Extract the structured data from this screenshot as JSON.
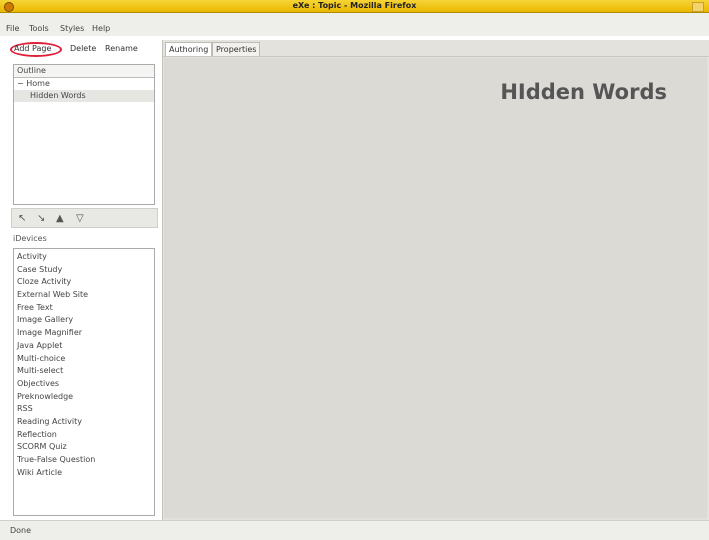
{
  "window": {
    "title": "eXe : Topic - Mozilla Firefox"
  },
  "menu": [
    "File",
    "Tools",
    "Styles",
    "Help"
  ],
  "toolbar": {
    "add_page": "Add Page",
    "delete": "Delete",
    "rename": "Rename"
  },
  "outline": {
    "header": "Outline",
    "items": [
      "Home",
      "Hidden Words"
    ]
  },
  "idevices": {
    "header": "iDevices",
    "items": [
      "Activity",
      "Case Study",
      "Cloze Activity",
      "External Web Site",
      "Free Text",
      "Image Gallery",
      "Image Magnifier",
      "Java Applet",
      "Multi-choice",
      "Multi-select",
      "Objectives",
      "Preknowledge",
      "RSS",
      "Reading Activity",
      "Reflection",
      "SCORM Quiz",
      "True-False Question",
      "Wiki Article"
    ]
  },
  "tabs": [
    "Authoring",
    "Properties"
  ],
  "content": {
    "page_title": "HIdden Words"
  },
  "status": "Done"
}
